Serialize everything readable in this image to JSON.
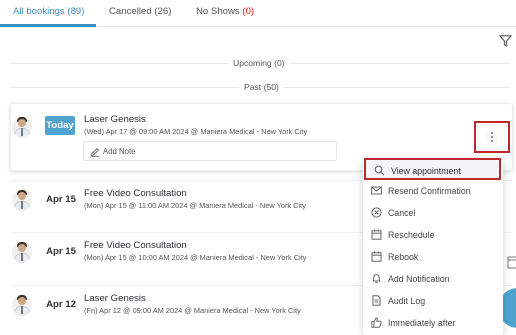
{
  "tabs": [
    {
      "label": "All bookings (89)"
    },
    {
      "label": "Cancelled (26)"
    },
    {
      "label": "No Shows",
      "count": "(0)"
    }
  ],
  "sections": {
    "upcoming": "Upcoming (0)",
    "past": "Past (50)"
  },
  "bookings": [
    {
      "badge": "Today",
      "title": "Laser Genesis",
      "subtitle": "(Wed) Apr 17 @ 09:00 AM 2024 @ Maniera Medical - New York City",
      "note_label": "Add Note"
    },
    {
      "badge": "Apr 15",
      "title": "Free Video Consultation",
      "subtitle": "(Mon) Apr 15 @ 11:00 AM 2024 @ Maniera Medical - New York City"
    },
    {
      "badge": "Apr 15",
      "title": "Free Video Consultation",
      "subtitle": "(Mon) Apr 15 @ 10:00 AM 2024 @ Maniera Medical - New York City"
    },
    {
      "badge": "Apr 12",
      "title": "Laser Genesis",
      "subtitle": "(Fri) Apr 12 @ 09:00 AM 2024 @ Maniera Medical - New York City"
    }
  ],
  "menu": {
    "items": [
      {
        "label": "View appointment",
        "icon": "search-icon"
      },
      {
        "label": "Resend Confirmation",
        "icon": "mail-icon"
      },
      {
        "label": "Cancel",
        "icon": "cancel-circle-icon"
      },
      {
        "label": "Reschedule",
        "icon": "calendar-icon"
      },
      {
        "label": "Rebook",
        "icon": "calendar-icon"
      },
      {
        "label": "Add Notification",
        "icon": "bell-icon"
      },
      {
        "label": "Audit Log",
        "icon": "document-icon"
      },
      {
        "label": "Immediately after",
        "icon": "thumbs-up-icon"
      }
    ]
  },
  "colors": {
    "accent": "#3a8fc4",
    "badge": "#4ea3cf",
    "highlight_border": "#c0282e",
    "no_show_count": "#e02020"
  }
}
